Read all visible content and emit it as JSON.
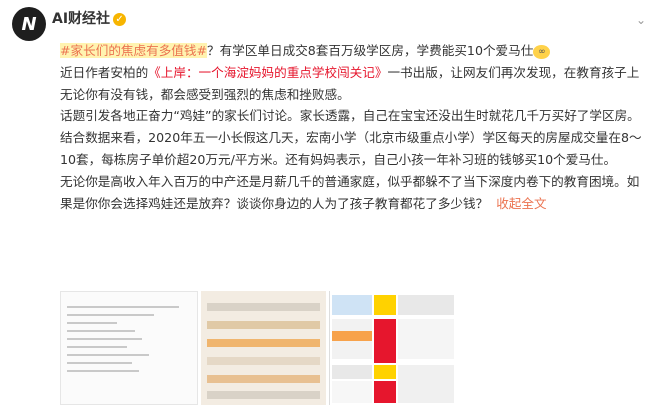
{
  "account": {
    "avatar_text": "N",
    "name": "AI财经社",
    "verified_icon": "verified-badge-icon"
  },
  "menu_icon": "chevron-down-icon",
  "post": {
    "hashtag": "#家长们的焦虑有多值钱#",
    "line1_rest": "？有学区单日成交8套百万级学区房，学费能买10个爱马仕",
    "emoji": "glasses-emoji",
    "p1a": "近日作者安柏的",
    "p1_book": "《上岸：一个海淀妈妈的重点学校闯关记》",
    "p1b": "一书出版，让网友们再次发现，在教育孩子上无论你有没有钱，都会感受到强烈的焦虑和挫败感。",
    "p2": "话题引发各地正奋力“鸡娃”的家长们讨论。家长透露，自己在宝宝还没出生时就花几千万买好了学区房。结合数据来看，2020年五一小长假这几天，宏南小学（北京市级重点小学）学区每天的房屋成交量在8～10套，每栋房子单价超20万元/平方米。还有妈妈表示，自己小孩一年补习班的钱够买10个爱马仕。",
    "p3": "无论你是高收入年入百万的中产还是月薪几千的普通家庭，似乎都躲不了当下深度内卷下的教育困境。如果是你你会选择鸡娃还是放弃？谈谈你身边的人为了孩子教育都花了多少钱？",
    "more": "收起全文"
  },
  "images": [
    {
      "name": "image-document-list"
    },
    {
      "name": "image-spreadsheet-photo"
    },
    {
      "name": "image-score-table"
    }
  ],
  "colors": {
    "link": "#eb7350",
    "red": "#e6162d",
    "text": "#333333"
  }
}
